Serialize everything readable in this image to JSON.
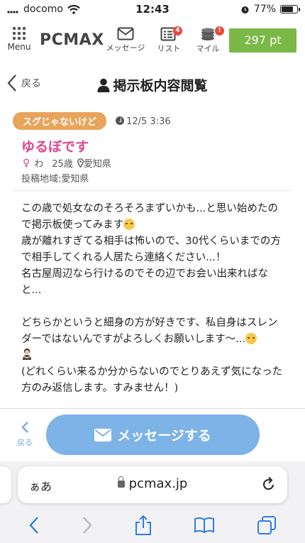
{
  "status_bar": {
    "carrier": "docomo",
    "time": "12:43",
    "battery": "77%",
    "battery_level": 0.77
  },
  "header": {
    "logo": "PCMAX",
    "menu_label": "Menu",
    "message_label": "メッセージ",
    "list_label": "リスト",
    "list_badge": "4",
    "mile_label": "マイル",
    "mile_badge": "!",
    "points": "297 pt",
    "points_color": "#7ab847"
  },
  "titlebar": {
    "back_label": "戻る",
    "title": "掲示板内容閲覧"
  },
  "post": {
    "tag": "スグじゃないけど",
    "timestamp": "12/5 3:36",
    "username": "ゆるぼです",
    "gender_symbol": "♀",
    "nickname_suffix": "わ",
    "age": "25歳",
    "location": "愛知県",
    "region": "投稿地域:愛知県",
    "body": {
      "line1": "この歳で処女なのそろそろまずいかも...と思い始めたので掲示板使ってみます",
      "line2": "歳が離れすぎてる相手は怖いので、30代くらいまでの方で相手してくれる人居たら連絡ください...！",
      "line3": "名古屋周辺なら行けるのでその辺でお会い出来ればなと...",
      "line4": "どちらかというと細身の方が好きです、私自身はスレンダーではないんですがよろしくお願いします〜...",
      "line5": "(どれくらい来るか分からないのでとりあえず気になった方のみ返信します。すみません！)"
    },
    "accent_color": "#e0458e",
    "tag_color": "#e8a45a"
  },
  "bottom": {
    "small_back_label": "戻る",
    "message_button": "メッセージする",
    "button_color": "#7eb3e8"
  },
  "safari": {
    "aa": "ぁあ",
    "url": "pcmax.jp"
  }
}
